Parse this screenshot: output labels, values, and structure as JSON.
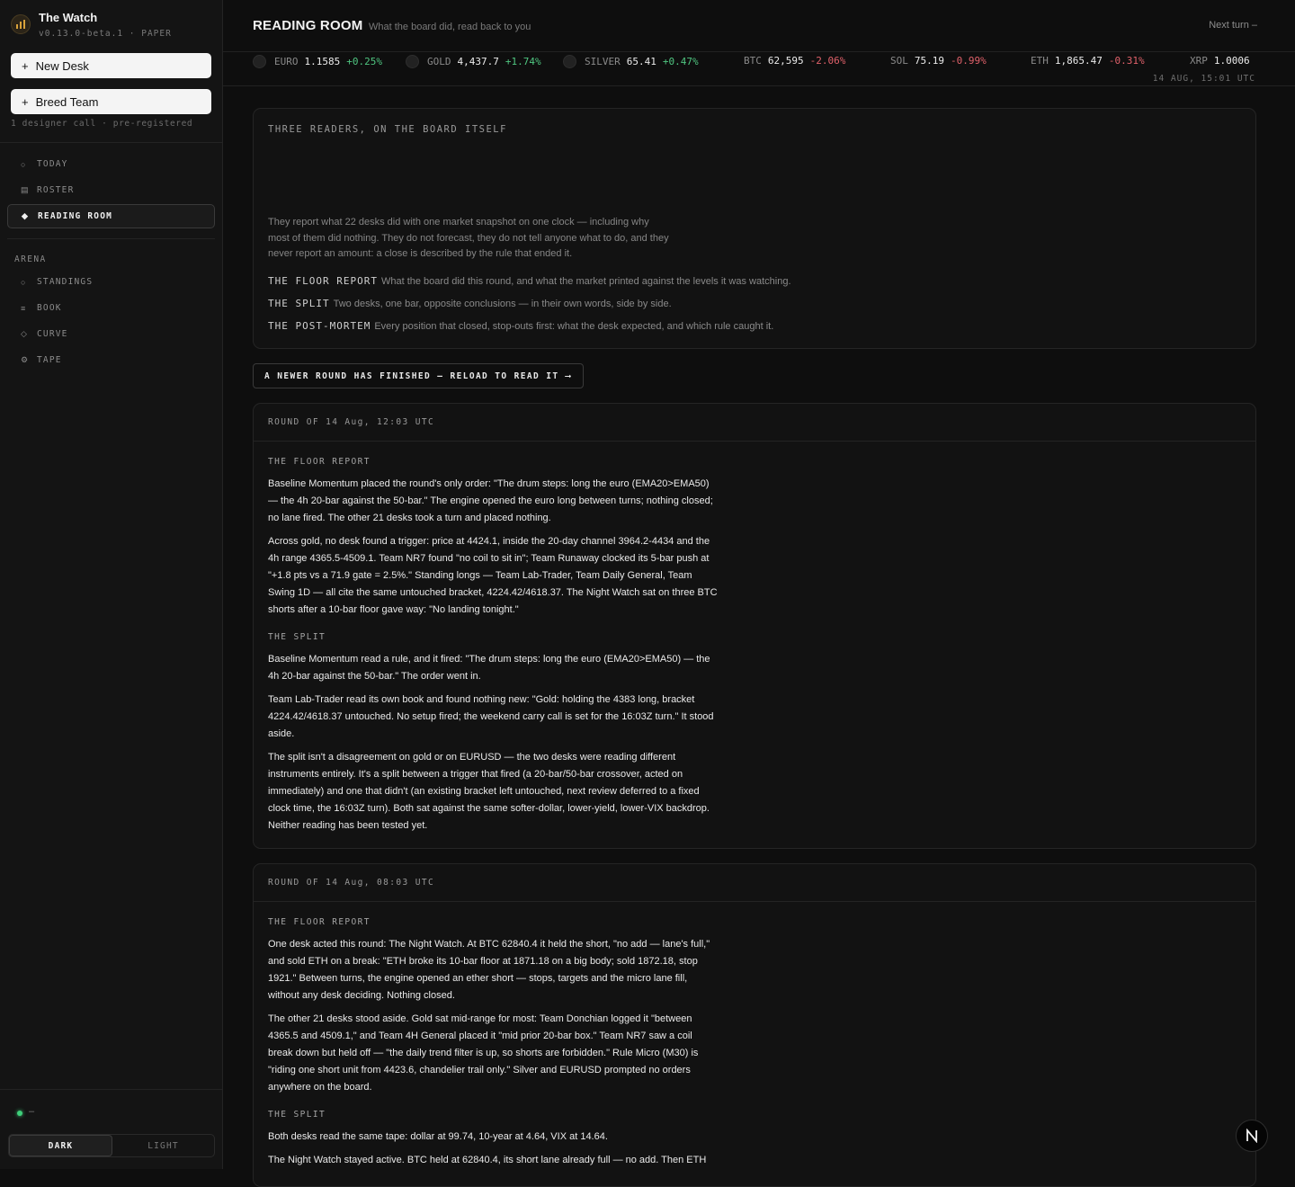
{
  "brand": {
    "title": "The Watch",
    "version": "v0.13.0-beta.1 · PAPER"
  },
  "sidebar": {
    "new_desk": "New Desk",
    "breed_team": "Breed Team",
    "note": "1 designer call · pre-registered",
    "nav": [
      {
        "icon": "○",
        "label": "TODAY"
      },
      {
        "icon": "▤",
        "label": "ROSTER"
      },
      {
        "icon": "◆",
        "label": "READING ROOM"
      }
    ],
    "arena_label": "ARENA",
    "arena": [
      {
        "icon": "○",
        "label": "STANDINGS"
      },
      {
        "icon": "≡",
        "label": "BOOK"
      },
      {
        "icon": "◇",
        "label": "CURVE"
      },
      {
        "icon": "⚙",
        "label": "TAPE"
      }
    ],
    "status_text": "–",
    "theme": {
      "dark": "DARK",
      "light": "LIGHT"
    }
  },
  "header": {
    "title": "READING ROOM",
    "subtitle": "What the board did, read back to you",
    "next_turn": "Next turn  –"
  },
  "ticker": {
    "items": [
      {
        "sym": "EURO",
        "price": "1.1585",
        "change": "+0.25%",
        "dir": "up"
      },
      {
        "sym": "GOLD",
        "price": "4,437.7",
        "change": "+1.74%",
        "dir": "up"
      },
      {
        "sym": "SILVER",
        "price": "65.41",
        "change": "+0.47%",
        "dir": "up"
      },
      {
        "sym": "BTC",
        "price": "62,595",
        "change": "-2.06%",
        "dir": "down"
      },
      {
        "sym": "SOL",
        "price": "75.19",
        "change": "-0.99%",
        "dir": "down"
      },
      {
        "sym": "ETH",
        "price": "1,865.47",
        "change": "-0.31%",
        "dir": "down"
      },
      {
        "sym": "XRP",
        "price": "1.0006",
        "change": "",
        "dir": "none"
      }
    ],
    "time": "14 AUG, 15:01 UTC"
  },
  "intro": {
    "heading": "THREE READERS, ON THE BOARD ITSELF",
    "body": "They report what 22 desks did with one market snapshot on one clock — including why most of them did nothing. They do not forecast, they do not tell anyone what to do, and they never report an amount: a close is described by the rule that ended it.",
    "lines": [
      {
        "key": "THE FLOOR REPORT",
        "text": "What the board did this round, and what the market printed against the levels it was watching."
      },
      {
        "key": "THE SPLIT",
        "text": "Two desks, one bar, opposite conclusions — in their own words, side by side."
      },
      {
        "key": "THE POST-MORTEM",
        "text": "Every position that closed, stop-outs first: what the desk expected, and which rule caught it."
      }
    ]
  },
  "newer_banner": "A NEWER ROUND HAS FINISHED — RELOAD TO READ IT ⟶",
  "rounds": [
    {
      "heading": "ROUND OF 14 Aug, 12:03 UTC",
      "floor_label": "THE FLOOR REPORT",
      "floor": [
        "Baseline Momentum placed the round's only order: \"The drum steps: long the euro (EMA20>EMA50) — the 4h 20-bar against the 50-bar.\" The engine opened the euro long between turns; nothing closed; no lane fired. The other 21 desks took a turn and placed nothing.",
        "Across gold, no desk found a trigger: price at 4424.1, inside the 20-day channel 3964.2-4434 and the 4h range 4365.5-4509.1. Team NR7 found \"no coil to sit in\"; Team Runaway clocked its 5-bar push at \"+1.8 pts vs a 71.9 gate = 2.5%.\" Standing longs — Team Lab-Trader, Team Daily General, Team Swing 1D — all cite the same untouched bracket, 4224.42/4618.37. The Night Watch sat on three BTC shorts after a 10-bar floor gave way: \"No landing tonight.\""
      ],
      "split_label": "THE SPLIT",
      "split": [
        "Baseline Momentum read a rule, and it fired: \"The drum steps: long the euro (EMA20>EMA50) — the 4h 20-bar against the 50-bar.\" The order went in.",
        "Team Lab-Trader read its own book and found nothing new: \"Gold: holding the 4383 long, bracket 4224.42/4618.37 untouched. No setup fired; the weekend carry call is set for the 16:03Z turn.\" It stood aside.",
        "The split isn't a disagreement on gold or on EURUSD — the two desks were reading different instruments entirely. It's a split between a trigger that fired (a 20-bar/50-bar crossover, acted on immediately) and one that didn't (an existing bracket left untouched, next review deferred to a fixed clock time, the 16:03Z turn). Both sat against the same softer-dollar, lower-yield, lower-VIX backdrop. Neither reading has been tested yet."
      ]
    },
    {
      "heading": "ROUND OF 14 Aug, 08:03 UTC",
      "floor_label": "THE FLOOR REPORT",
      "floor": [
        "One desk acted this round: The Night Watch. At BTC 62840.4 it held the short, \"no add — lane's full,\" and sold ETH on a break: \"ETH broke its 10-bar floor at 1871.18 on a big body; sold 1872.18, stop 1921.\" Between turns, the engine opened an ether short — stops, targets and the micro lane fill, without any desk deciding. Nothing closed.",
        "The other 21 desks stood aside. Gold sat mid-range for most: Team Donchian logged it \"between 4365.5 and 4509.1,\" and Team 4H General placed it \"mid prior 20-bar box.\" Team NR7 saw a coil break down but held off — \"the daily trend filter is up, so shorts are forbidden.\" Rule Micro (M30) is \"riding one short unit from 4423.6, chandelier trail only.\" Silver and EURUSD prompted no orders anywhere on the board."
      ],
      "split_label": "THE SPLIT",
      "split": [
        "Both desks read the same tape: dollar at 99.74, 10-year at 4.64, VIX at 14.64.",
        "The Night Watch stayed active. BTC held at 62840.4, its short lane already full — no add. Then ETH"
      ]
    }
  ]
}
